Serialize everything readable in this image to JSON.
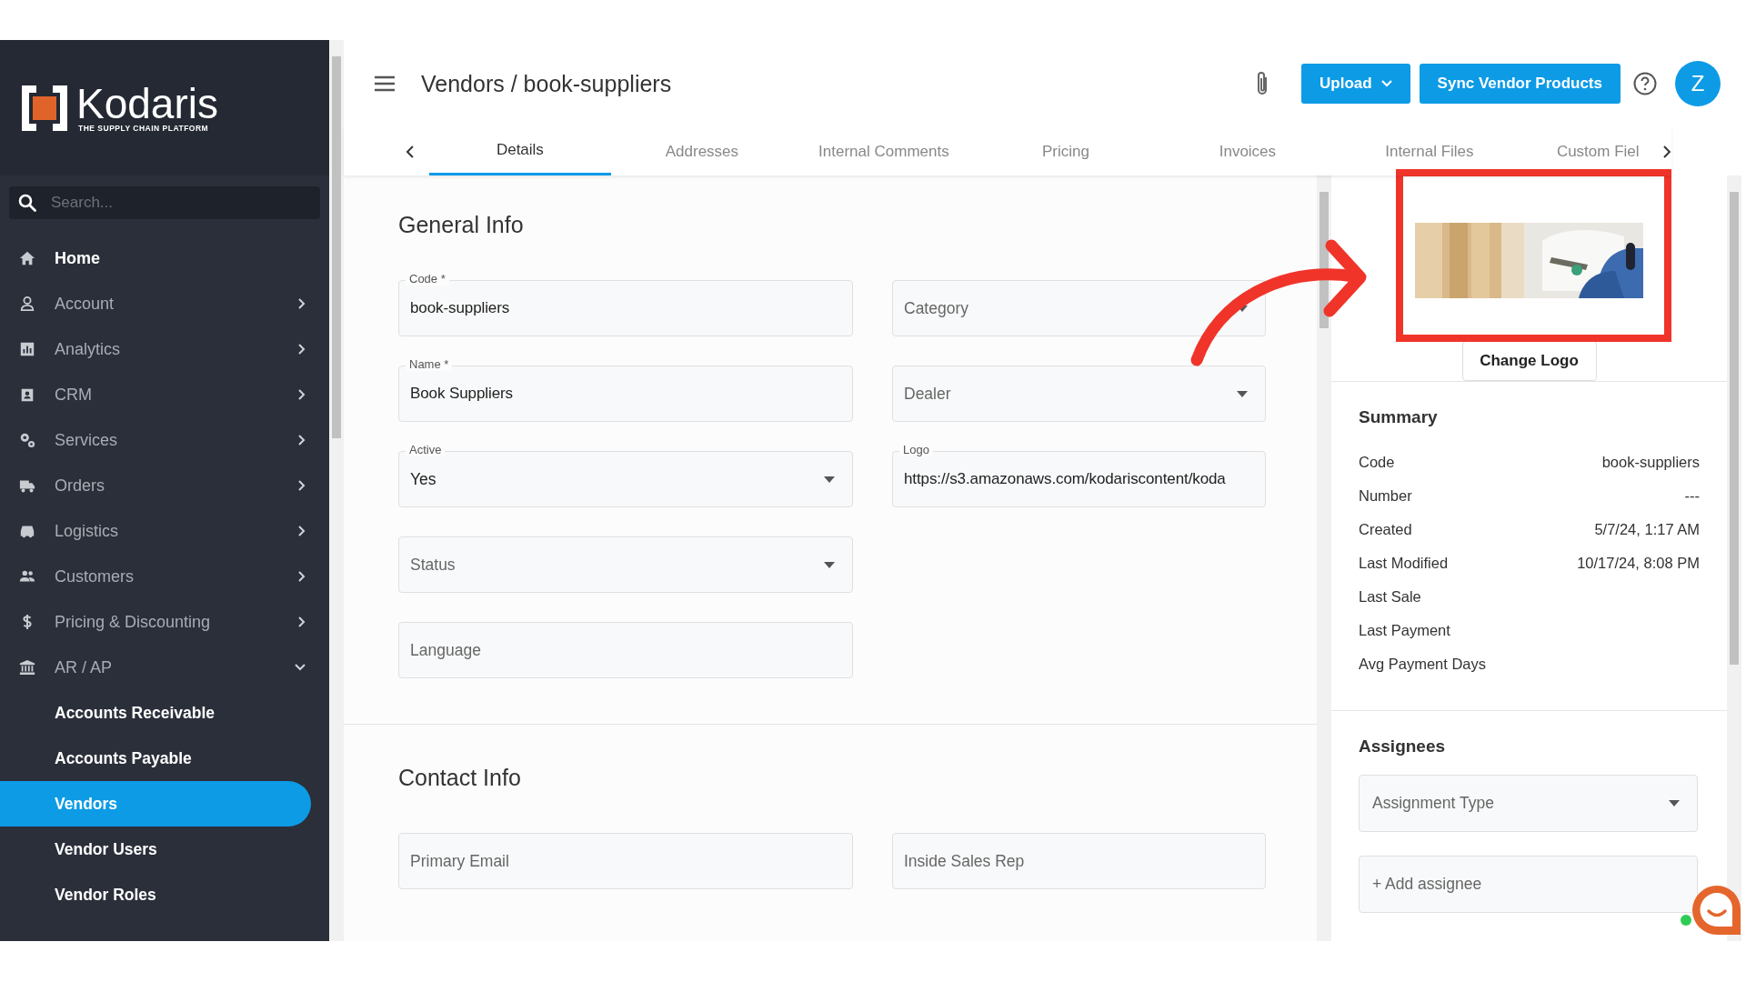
{
  "sidebar": {
    "logo": {
      "name": "Kodaris",
      "tagline": "THE SUPPLY CHAIN PLATFORM"
    },
    "search": {
      "placeholder": "Search..."
    },
    "items": [
      {
        "label": "Home",
        "kind": "link"
      },
      {
        "label": "Account",
        "kind": "group",
        "expanded": false
      },
      {
        "label": "Analytics",
        "kind": "group",
        "expanded": false
      },
      {
        "label": "CRM",
        "kind": "group",
        "expanded": false
      },
      {
        "label": "Services",
        "kind": "group",
        "expanded": false
      },
      {
        "label": "Orders",
        "kind": "group",
        "expanded": false
      },
      {
        "label": "Logistics",
        "kind": "group",
        "expanded": false
      },
      {
        "label": "Customers",
        "kind": "group",
        "expanded": false
      },
      {
        "label": "Pricing & Discounting",
        "kind": "group",
        "expanded": false
      },
      {
        "label": "AR / AP",
        "kind": "group",
        "expanded": true,
        "children": [
          {
            "label": "Accounts Receivable",
            "selected": false
          },
          {
            "label": "Accounts Payable",
            "selected": false
          },
          {
            "label": "Vendors",
            "selected": true
          },
          {
            "label": "Vendor Users",
            "selected": false
          },
          {
            "label": "Vendor Roles",
            "selected": false
          }
        ]
      }
    ]
  },
  "header": {
    "title": "Vendors / book-suppliers",
    "buttons": [
      {
        "label": "Upload",
        "kind": "dropdown"
      },
      {
        "label": "Sync Vendor Products",
        "kind": "plain"
      }
    ],
    "avatar": "Z"
  },
  "tabs": [
    {
      "label": "Details",
      "selected": true
    },
    {
      "label": "Addresses",
      "selected": false
    },
    {
      "label": "Internal Comments",
      "selected": false
    },
    {
      "label": "Pricing",
      "selected": false
    },
    {
      "label": "Invoices",
      "selected": false
    },
    {
      "label": "Internal Files",
      "selected": false
    },
    {
      "label": "Custom Fiel",
      "selected": false
    }
  ],
  "general_info": {
    "title": "General Info",
    "left": [
      {
        "kind": "text",
        "label": "Code *",
        "value": "book-suppliers"
      },
      {
        "kind": "text",
        "label": "Name *",
        "value": "Book Suppliers"
      },
      {
        "kind": "select",
        "label": "Active",
        "value": "Yes"
      },
      {
        "kind": "select",
        "placeholder": "Status"
      },
      {
        "kind": "text",
        "placeholder": "Language"
      }
    ],
    "right": [
      {
        "kind": "select",
        "placeholder": "Category"
      },
      {
        "kind": "select",
        "placeholder": "Dealer"
      },
      {
        "kind": "text",
        "label": "Logo",
        "value": "https://s3.amazonaws.com/kodariscontent/koda"
      }
    ]
  },
  "contact_info": {
    "title": "Contact Info",
    "fields": [
      {
        "placeholder": "Primary Email"
      },
      {
        "placeholder": "Inside Sales Rep"
      }
    ]
  },
  "logo_panel": {
    "button": "Change Logo"
  },
  "summary": {
    "title": "Summary",
    "rows": [
      {
        "label": "Code",
        "value": "book-suppliers"
      },
      {
        "label": "Number",
        "value": "---"
      },
      {
        "label": "Created",
        "value": "5/7/24, 1:17 AM"
      },
      {
        "label": "Last Modified",
        "value": "10/17/24, 8:08 PM"
      },
      {
        "label": "Last Sale"
      },
      {
        "label": "Last Payment"
      },
      {
        "label": "Avg Payment Days"
      }
    ]
  },
  "assignees": {
    "title": "Assignees",
    "fields": [
      {
        "kind": "select",
        "placeholder": "Assignment Type"
      },
      {
        "kind": "text",
        "placeholder": "+ Add assignee"
      }
    ]
  }
}
